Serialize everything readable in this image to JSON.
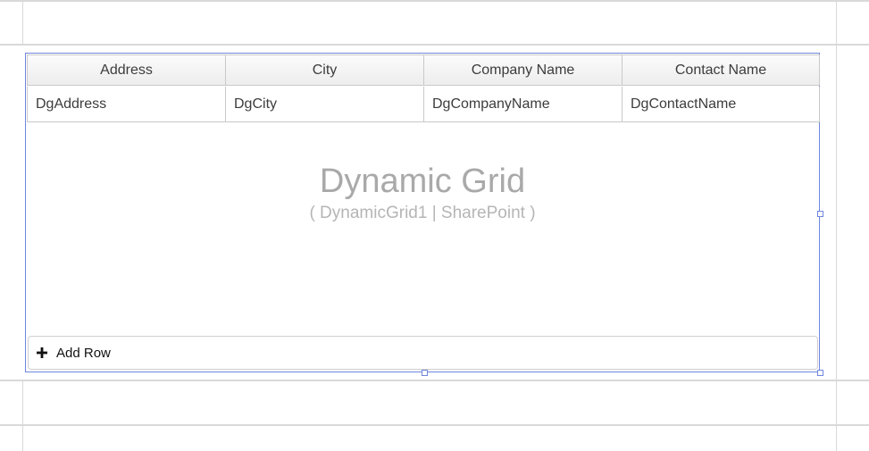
{
  "grid": {
    "columns": [
      {
        "header": "Address",
        "value": "DgAddress"
      },
      {
        "header": "City",
        "value": "DgCity"
      },
      {
        "header": "Company Name",
        "value": "DgCompanyName"
      },
      {
        "header": "Contact Name",
        "value": "DgContactName"
      }
    ],
    "placeholder_title": "Dynamic Grid",
    "placeholder_subtitle": "( DynamicGrid1 | SharePoint )",
    "add_row_label": "Add Row",
    "add_row_icon": "plus-icon"
  },
  "colors": {
    "selection_border": "#6f86de",
    "grid_lines": "#d9d9d9"
  }
}
